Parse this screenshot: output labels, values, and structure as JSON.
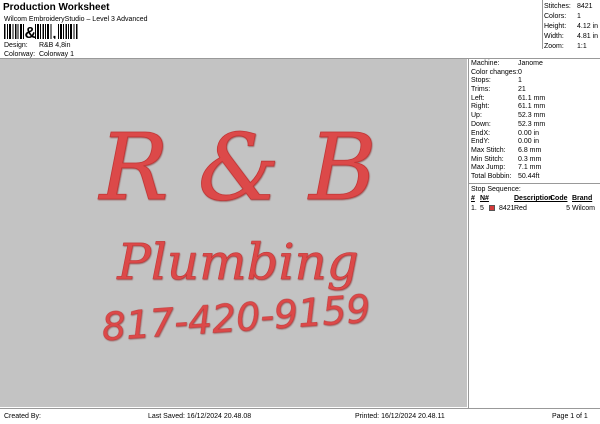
{
  "header": {
    "title": "Production Worksheet",
    "subtitle": "Wilcom EmbroideryStudio – Level 3 Advanced",
    "design_label": "Design:",
    "design_value": "R&B 4,8in",
    "colorway_label": "Colorway:",
    "colorway_value": "Colorway 1"
  },
  "stats": [
    {
      "label": "Stitches:",
      "value": "8421"
    },
    {
      "label": "Colors:",
      "value": "1"
    },
    {
      "label": "Height:",
      "value": "4.12 in"
    },
    {
      "label": "Width:",
      "value": "4.81 in"
    },
    {
      "label": "Zoom:",
      "value": "1:1"
    }
  ],
  "design": {
    "line1": "R & B",
    "line2": "Plumbing",
    "line3": "817-420-9159",
    "thread_color": "#dc4a4a",
    "background_color": "#c3c3c3"
  },
  "details": [
    {
      "label": "Machine:",
      "value": "Janome"
    },
    {
      "label": "Color changes:",
      "value": "0"
    },
    {
      "label": "Stops:",
      "value": "1"
    },
    {
      "label": "Trims:",
      "value": "21"
    },
    {
      "label": "Left:",
      "value": "61.1 mm"
    },
    {
      "label": "Right:",
      "value": "61.1 mm"
    },
    {
      "label": "Up:",
      "value": "52.3 mm"
    },
    {
      "label": "Down:",
      "value": "52.3 mm"
    },
    {
      "label": "EndX:",
      "value": "0.00 in"
    },
    {
      "label": "EndY:",
      "value": "0.00 in"
    },
    {
      "label": "Max Stitch:",
      "value": "6.8 mm"
    },
    {
      "label": "Min Stitch:",
      "value": "0.3 mm"
    },
    {
      "label": "Max Jump:",
      "value": "7.1 mm"
    },
    {
      "label": "Total Bobbin:",
      "value": "50.44ft"
    }
  ],
  "stop_sequence": {
    "title": "Stop Sequence:",
    "headers": {
      "no": "#",
      "n": "N#",
      "description": "Description",
      "code": "Code",
      "brand": "Brand"
    },
    "rows": [
      {
        "no": "1.",
        "n": "5",
        "stitches": "8421",
        "description": "Red",
        "code": "5",
        "brand": "Wilcom",
        "color": "#d63a3a"
      }
    ]
  },
  "footer": {
    "created_by": "Created By:",
    "last_saved": "Last Saved: 16/12/2024 20.48.08",
    "printed": "Printed: 16/12/2024 20.48.11",
    "page": "Page 1 of 1"
  }
}
